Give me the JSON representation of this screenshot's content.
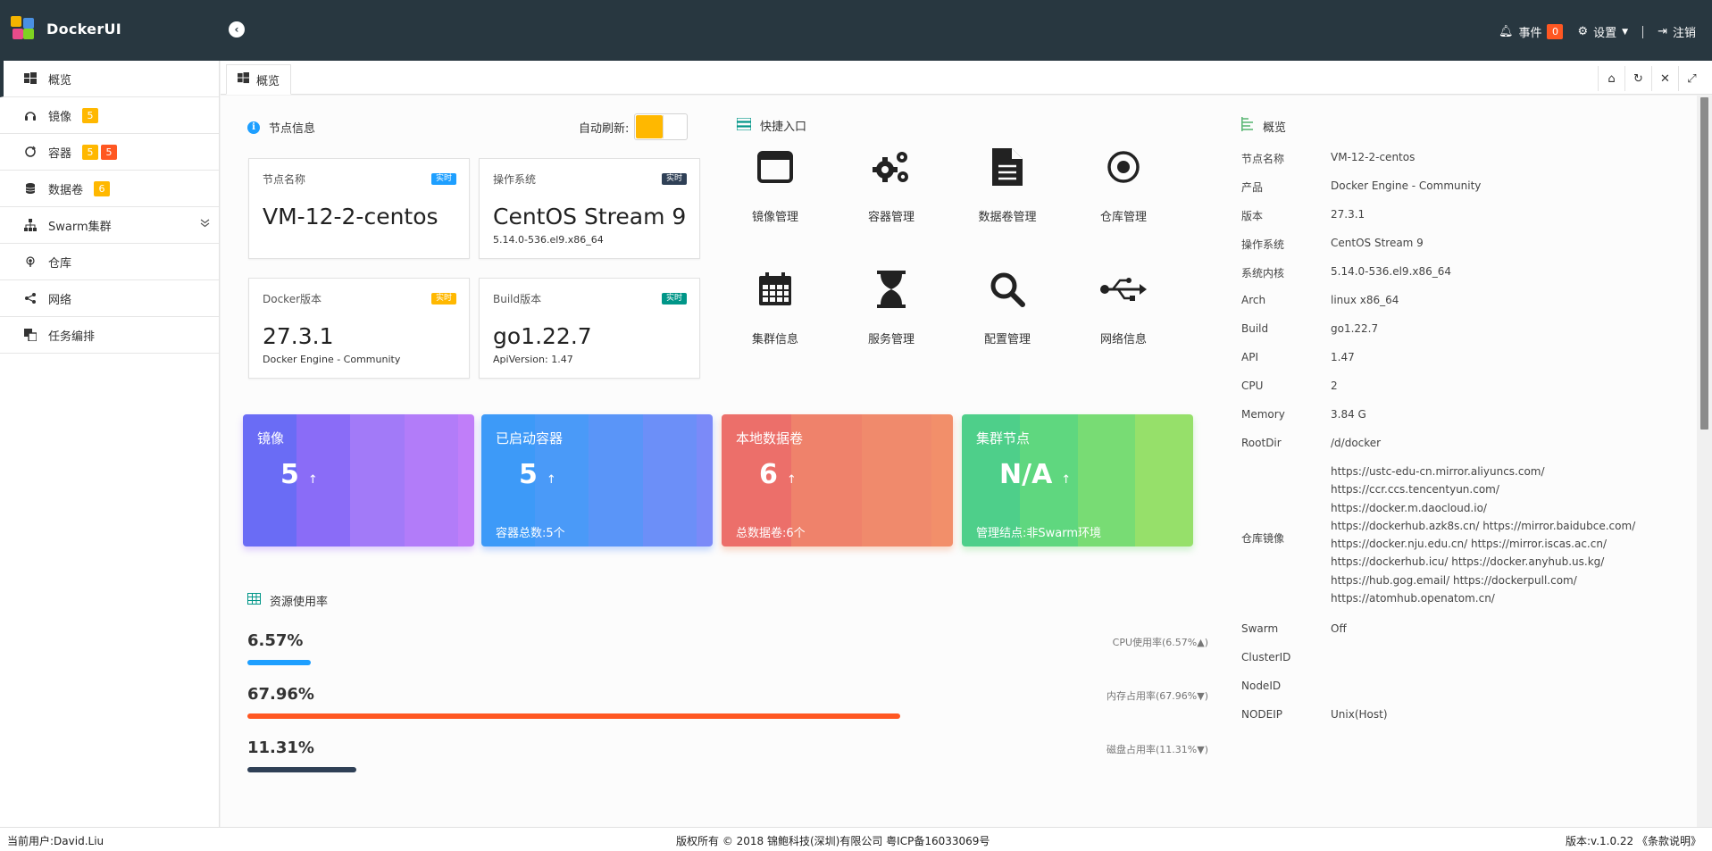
{
  "header": {
    "brand": "DockerUI",
    "events_label": "事件",
    "events_count": "0",
    "settings_label": "设置",
    "logout_label": "注销"
  },
  "sidebar": {
    "items": [
      {
        "label": "概览",
        "icon": "windows-icon"
      },
      {
        "label": "镜像",
        "icon": "headphones-icon",
        "badges": [
          "5"
        ]
      },
      {
        "label": "容器",
        "icon": "refresh-circle-icon",
        "badges": [
          "5",
          "5"
        ]
      },
      {
        "label": "数据卷",
        "icon": "database-icon",
        "badges": [
          "6"
        ]
      },
      {
        "label": "Swarm集群",
        "icon": "sitemap-icon"
      },
      {
        "label": "仓库",
        "icon": "broadcast-icon"
      },
      {
        "label": "网络",
        "icon": "share-icon"
      },
      {
        "label": "任务编排",
        "icon": "layers-icon"
      }
    ]
  },
  "tabs": {
    "active_label": "概览"
  },
  "node_info": {
    "title": "节点信息",
    "auto_refresh_label": "自动刷新:",
    "cards": [
      {
        "label": "节点名称",
        "tag": "实时",
        "value": "VM-12-2-centos",
        "sub": ""
      },
      {
        "label": "操作系统",
        "tag": "实时",
        "value": "CentOS Stream 9",
        "sub": "5.14.0-536.el9.x86_64"
      },
      {
        "label": "Docker版本",
        "tag": "实时",
        "value": "27.3.1",
        "sub": "Docker Engine - Community"
      },
      {
        "label": "Build版本",
        "tag": "实时",
        "value": "go1.22.7",
        "sub": "ApiVersion: 1.47"
      }
    ]
  },
  "quick_entry": {
    "title": "快捷入口",
    "items": [
      {
        "label": "镜像管理",
        "icon": "window-icon"
      },
      {
        "label": "容器管理",
        "icon": "gears-icon"
      },
      {
        "label": "数据卷管理",
        "icon": "document-icon"
      },
      {
        "label": "仓库管理",
        "icon": "target-icon"
      },
      {
        "label": "集群信息",
        "icon": "calendar-icon"
      },
      {
        "label": "服务管理",
        "icon": "hourglass-icon"
      },
      {
        "label": "配置管理",
        "icon": "search-icon"
      },
      {
        "label": "网络信息",
        "icon": "usb-icon"
      }
    ]
  },
  "stats": [
    {
      "title": "镜像",
      "value": "5",
      "arrow": "↑",
      "foot": ""
    },
    {
      "title": "已启动容器",
      "value": "5",
      "arrow": "↑",
      "foot": "容器总数:5个"
    },
    {
      "title": "本地数据卷",
      "value": "6",
      "arrow": "↑",
      "foot": "总数据卷:6个"
    },
    {
      "title": "集群节点",
      "value": "N/A",
      "arrow": "↑",
      "foot": "管理结点:非Swarm环境"
    }
  ],
  "resources": {
    "title": "资源使用率",
    "rows": [
      {
        "pct": "6.57%",
        "label": "CPU使用率(6.57%▲)",
        "fraction": 0.0657,
        "color": "#1e9fff"
      },
      {
        "pct": "67.96%",
        "label": "内存占用率(67.96%▼)",
        "fraction": 0.6796,
        "color": "#ff5722"
      },
      {
        "pct": "11.31%",
        "label": "磁盘占用率(11.31%▼)",
        "fraction": 0.1131,
        "color": "#2f4056"
      }
    ]
  },
  "overview": {
    "title": "概览",
    "rows": [
      {
        "k": "节点名称",
        "v": "VM-12-2-centos"
      },
      {
        "k": "产品",
        "v": "Docker Engine - Community"
      },
      {
        "k": "版本",
        "v": "27.3.1"
      },
      {
        "k": "操作系统",
        "v": "CentOS Stream 9"
      },
      {
        "k": "系统内核",
        "v": "5.14.0-536.el9.x86_64"
      },
      {
        "k": "Arch",
        "v": "linux x86_64"
      },
      {
        "k": "Build",
        "v": "go1.22.7"
      },
      {
        "k": "API",
        "v": "1.47"
      },
      {
        "k": "CPU",
        "v": "2"
      },
      {
        "k": "Memory",
        "v": "3.84 G"
      },
      {
        "k": "RootDir",
        "v": "/d/docker"
      }
    ],
    "registry_label": "仓库镜像",
    "registry_lines": [
      "https://ustc-edu-cn.mirror.aliyuncs.com/",
      "https://ccr.ccs.tencentyun.com/",
      "https://docker.m.daocloud.io/",
      "https://dockerhub.azk8s.cn/ https://mirror.baidubce.com/",
      "https://docker.nju.edu.cn/ https://mirror.iscas.ac.cn/",
      "https://dockerhub.icu/ https://docker.anyhub.us.kg/",
      "https://hub.gog.email/ https://dockerpull.com/",
      "https://atomhub.openatom.cn/"
    ],
    "rows2": [
      {
        "k": "Swarm",
        "v": "Off"
      },
      {
        "k": "ClusterID",
        "v": ""
      },
      {
        "k": "NodeID",
        "v": ""
      },
      {
        "k": "NODEIP",
        "v": "Unix(Host)"
      }
    ]
  },
  "footer": {
    "user": "当前用户:David.Liu",
    "copyright": "版权所有 © 2018 锦鲍科技(深圳)有限公司 粤ICP备16033069号",
    "version": "版本:v.1.0.22 《条款说明》"
  }
}
